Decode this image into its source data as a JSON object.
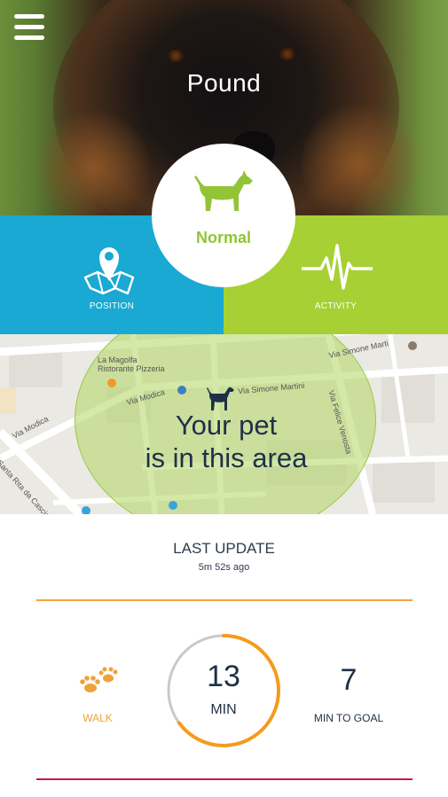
{
  "header": {
    "pet_name": "Pound",
    "menu_icon": "hamburger-menu-icon"
  },
  "status": {
    "label": "Normal",
    "icon": "dog-icon",
    "color": "#92c436"
  },
  "tiles": {
    "position": {
      "label": "POSITION",
      "icon": "map-pin-icon",
      "color": "#19a9d2"
    },
    "activity": {
      "label": "ACTIVITY",
      "icon": "heartbeat-icon",
      "color": "#a6d033"
    }
  },
  "map": {
    "area_line1": "Your pet",
    "area_line2": "is in this area",
    "labels": {
      "pizzeria_1": "La Magolfa",
      "pizzeria_2": "Ristorante Pizzeria",
      "via_modica_1": "Via Modica",
      "via_modica_2": "Via Modica",
      "santa_rita": "Santa Rita da Cascia",
      "simone_martini_1": "Via Simone Martini",
      "simone_martini_2": "Via Simone Marti",
      "felice_venosta": "Via Felice Venosta"
    }
  },
  "last_update": {
    "title": "LAST UPDATE",
    "time": "5m 52s ago"
  },
  "activity_stats": {
    "walk_label": "WALK",
    "walk_icon": "paw-prints-icon",
    "minutes_value": "13",
    "minutes_unit": "MIN",
    "goal_value": "7",
    "goal_label": "MIN TO GOAL",
    "progress_fraction": 0.65,
    "accent": "#f0a23a",
    "separator_color": "#c2185b"
  }
}
